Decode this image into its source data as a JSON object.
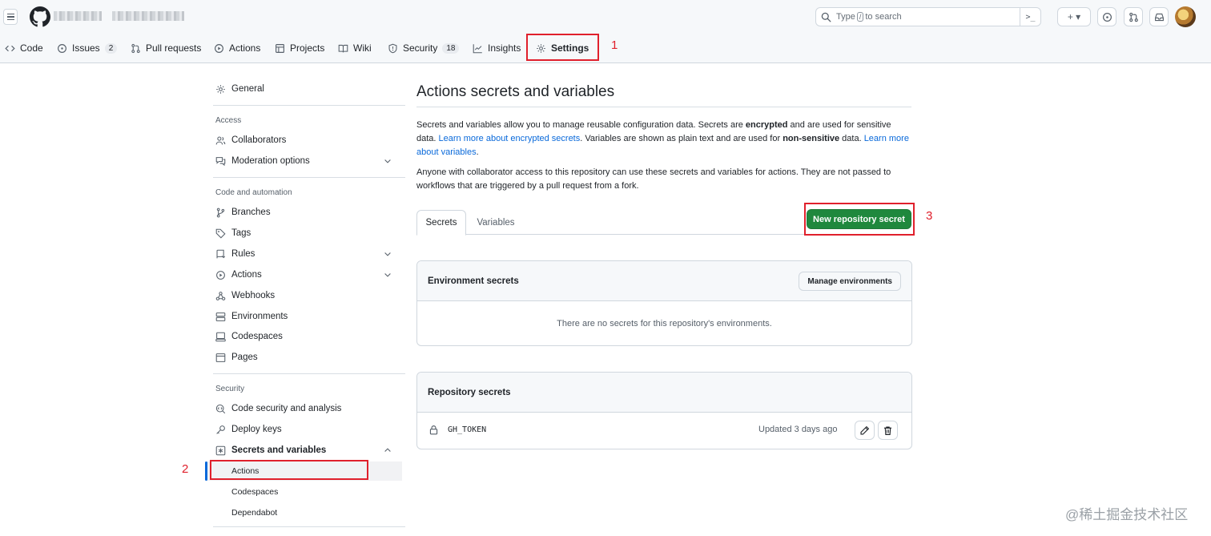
{
  "header": {
    "search_prefix": "Type",
    "search_key": "/",
    "search_suffix": "to search",
    "terminal_glyph": ">_",
    "plus_glyph": "+ ▾"
  },
  "repo_nav": {
    "code": "Code",
    "issues": "Issues",
    "issues_count": "2",
    "pulls": "Pull requests",
    "actions": "Actions",
    "projects": "Projects",
    "wiki": "Wiki",
    "security": "Security",
    "security_count": "18",
    "insights": "Insights",
    "settings": "Settings"
  },
  "annotations": {
    "one": "1",
    "two": "2",
    "three": "3"
  },
  "sidebar": {
    "general": "General",
    "access_heading": "Access",
    "collaborators": "Collaborators",
    "moderation": "Moderation options",
    "code_heading": "Code and automation",
    "branches": "Branches",
    "tags": "Tags",
    "rules": "Rules",
    "actions": "Actions",
    "webhooks": "Webhooks",
    "environments": "Environments",
    "codespaces": "Codespaces",
    "pages": "Pages",
    "security_heading": "Security",
    "code_security": "Code security and analysis",
    "deploy_keys": "Deploy keys",
    "secrets_vars": "Secrets and variables",
    "sub_actions": "Actions",
    "sub_codespaces": "Codespaces",
    "sub_dependabot": "Dependabot"
  },
  "main": {
    "title": "Actions secrets and variables",
    "p1_a": "Secrets and variables allow you to manage reusable configuration data. Secrets are ",
    "p1_b": "encrypted",
    "p1_c": " and are used for sensitive data. ",
    "p1_link1": "Learn more about encrypted secrets",
    "p1_d": ". Variables are shown as plain text and are used for ",
    "p1_e": "non-sensitive",
    "p1_f": " data. ",
    "p1_link2": "Learn more about variables",
    "p1_g": ".",
    "p2": "Anyone with collaborator access to this repository can use these secrets and variables for actions. They are not passed to workflows that are triggered by a pull request from a fork.",
    "tab_secrets": "Secrets",
    "tab_variables": "Variables",
    "new_secret_button": "New repository secret",
    "env_secrets_title": "Environment secrets",
    "manage_env_button": "Manage environments",
    "env_empty": "There are no secrets for this repository's environments.",
    "repo_secrets_title": "Repository secrets",
    "secret_name": "GH_TOKEN",
    "secret_updated": "Updated 3 days ago"
  },
  "watermark": "@稀土掘金技术社区"
}
